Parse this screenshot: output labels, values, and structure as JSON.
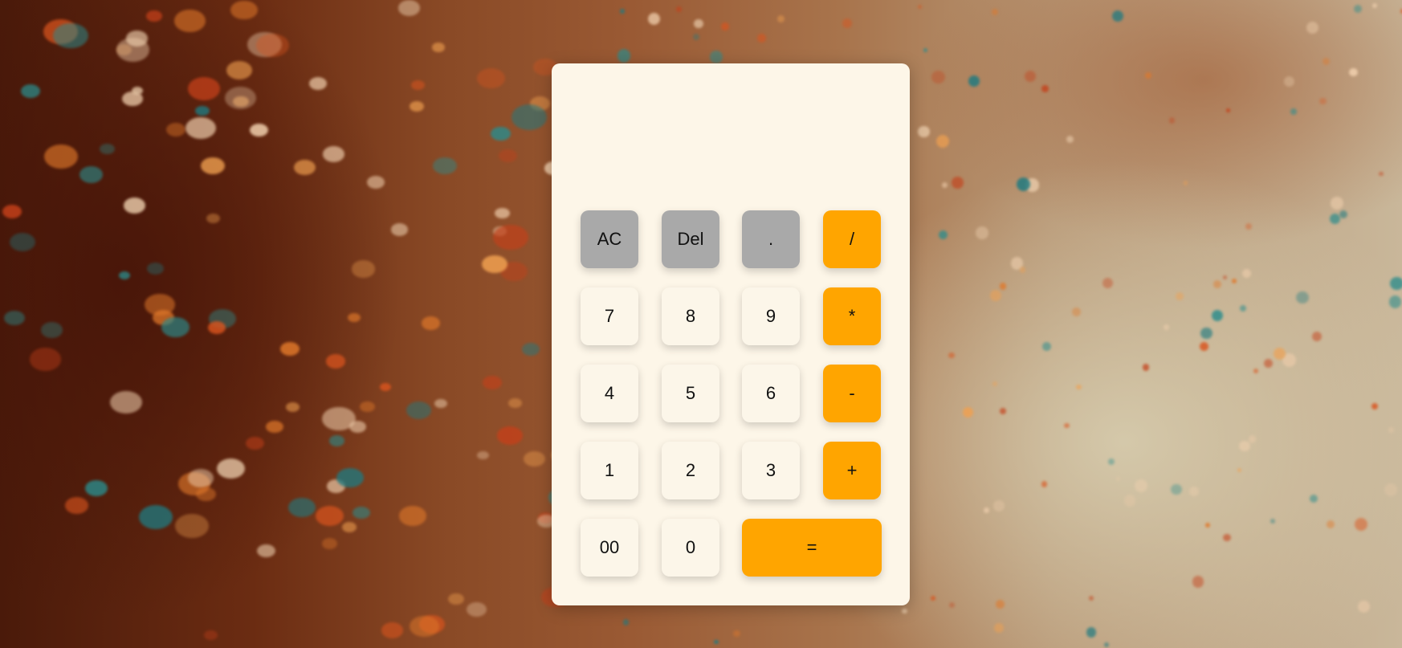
{
  "calculator": {
    "display_value": "",
    "rows": [
      [
        {
          "label": "AC",
          "name": "all-clear-button",
          "kind": "fn"
        },
        {
          "label": "Del",
          "name": "delete-button",
          "kind": "fn"
        },
        {
          "label": ".",
          "name": "decimal-button",
          "kind": "fn"
        },
        {
          "label": "/",
          "name": "divide-button",
          "kind": "op"
        }
      ],
      [
        {
          "label": "7",
          "name": "digit-7-button",
          "kind": "num"
        },
        {
          "label": "8",
          "name": "digit-8-button",
          "kind": "num"
        },
        {
          "label": "9",
          "name": "digit-9-button",
          "kind": "num"
        },
        {
          "label": "*",
          "name": "multiply-button",
          "kind": "op"
        }
      ],
      [
        {
          "label": "4",
          "name": "digit-4-button",
          "kind": "num"
        },
        {
          "label": "5",
          "name": "digit-5-button",
          "kind": "num"
        },
        {
          "label": "6",
          "name": "digit-6-button",
          "kind": "num"
        },
        {
          "label": "-",
          "name": "subtract-button",
          "kind": "op"
        }
      ],
      [
        {
          "label": "1",
          "name": "digit-1-button",
          "kind": "num"
        },
        {
          "label": "2",
          "name": "digit-2-button",
          "kind": "num"
        },
        {
          "label": "3",
          "name": "digit-3-button",
          "kind": "num"
        },
        {
          "label": "+",
          "name": "add-button",
          "kind": "op"
        }
      ],
      [
        {
          "label": "00",
          "name": "double-zero-button",
          "kind": "num"
        },
        {
          "label": "0",
          "name": "digit-0-button",
          "kind": "num"
        },
        {
          "label": "=",
          "name": "equals-button",
          "kind": "op"
        }
      ]
    ]
  },
  "colors": {
    "panel": "#fdf6e8",
    "number_key": "#fcf6e9",
    "function_key": "#a9a9a9",
    "operator_key": "#ffa500"
  }
}
